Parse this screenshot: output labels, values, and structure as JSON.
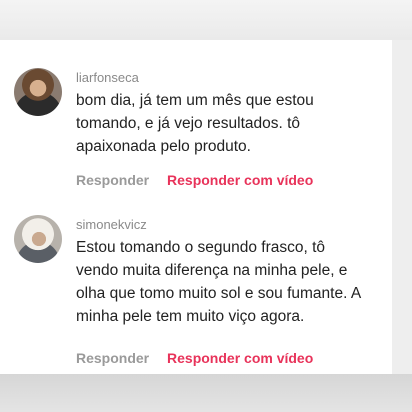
{
  "comments": [
    {
      "username": "liarfonseca",
      "lines": [
        "bom dia, já tem um mês que estou",
        "tomando, e já vejo resultados. tô",
        "apaixonada pelo produto."
      ],
      "reply_label": "Responder",
      "reply_video_label": "Responder com vídeo"
    },
    {
      "username": "simonekvicz",
      "lines": [
        "Estou tomando o segundo frasco, tô",
        "vendo muita diferença na minha pele, e",
        "olha que tomo muito sol e sou fumante. A",
        "minha pele tem muito viço agora."
      ],
      "reply_label": "Responder",
      "reply_video_label": "Responder com vídeo"
    }
  ],
  "colors": {
    "accent": "#e8335a",
    "muted": "#9a9a9a",
    "text": "#222222"
  }
}
